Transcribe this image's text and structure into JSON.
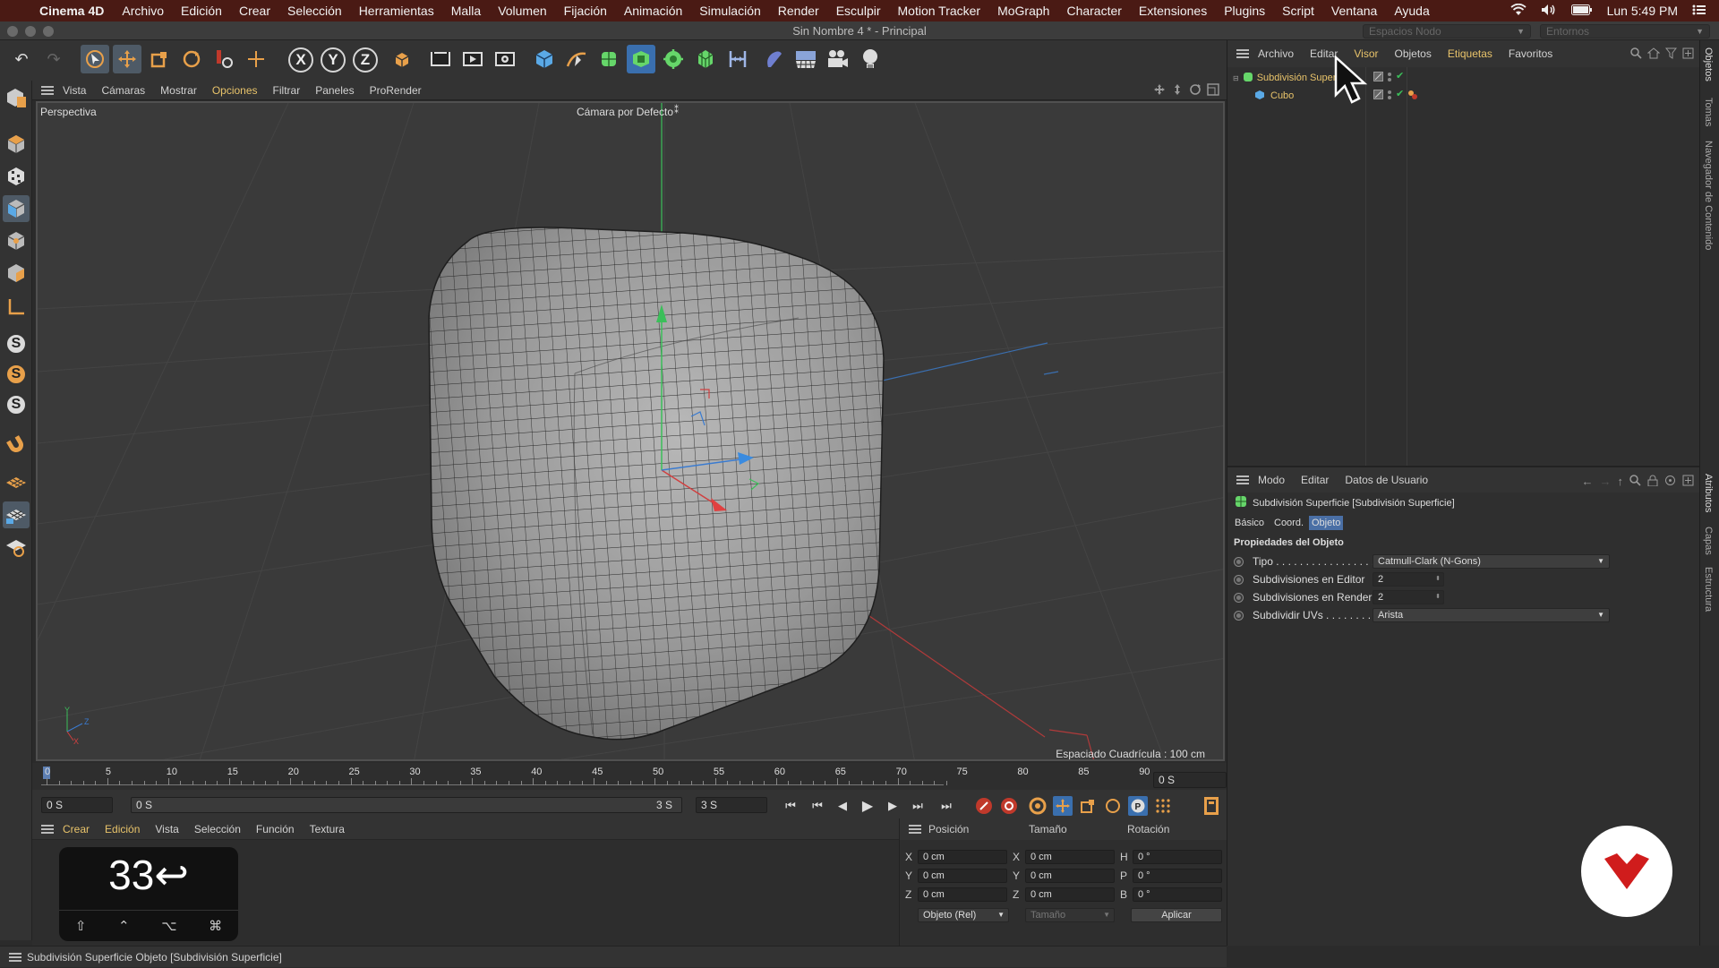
{
  "mac": {
    "app_name": "Cinema 4D",
    "menus": [
      "Archivo",
      "Edición",
      "Crear",
      "Selección",
      "Herramientas",
      "Malla",
      "Volumen",
      "Fijación",
      "Animación",
      "Simulación",
      "Render",
      "Esculpir",
      "Motion Tracker",
      "MoGraph",
      "Character",
      "Extensiones",
      "Plugins",
      "Script",
      "Ventana",
      "Ayuda"
    ],
    "clock": "Lun 5:49 PM"
  },
  "window": {
    "title": "Sin Nombre 4 * - Principal",
    "layout_combo": "Espacios Nodo",
    "env_combo": "Entornos"
  },
  "viewport": {
    "menu": [
      "Vista",
      "Cámaras",
      "Mostrar",
      "Opciones",
      "Filtrar",
      "Paneles",
      "ProRender"
    ],
    "highlight_menu": "Opciones",
    "view_name": "Perspectiva",
    "camera": "Cámara por Defecto",
    "grid_spacing": "Espaciado Cuadrícula : 100 cm",
    "axis_y": "Y",
    "axis_z": "Z",
    "axis_x": "X"
  },
  "timeline": {
    "ticks": [
      "0",
      "5",
      "10",
      "15",
      "20",
      "25",
      "30",
      "35",
      "40",
      "45",
      "50",
      "55",
      "60",
      "65",
      "70",
      "75",
      "80",
      "85",
      "90"
    ],
    "current_frame": "0 S",
    "start": "0 S",
    "range_start": "0 S",
    "range_end": "3 S",
    "end": "3 S"
  },
  "material": {
    "menu": [
      "Crear",
      "Edición",
      "Vista",
      "Selección",
      "Función",
      "Textura"
    ],
    "highlight_menu": [
      "Crear",
      "Edición"
    ],
    "keycast_number": "33",
    "keycast_return": "↩",
    "keycast_keys": [
      "⇧",
      "⌃",
      "⌥",
      "⌘"
    ]
  },
  "coords": {
    "headers": {
      "position": "Posición",
      "size": "Tamaño",
      "rotation": "Rotación"
    },
    "rows": [
      {
        "axis": "X",
        "pos": "0 cm",
        "size_axis": "X",
        "size": "0 cm",
        "rot_axis": "H",
        "rot": "0 °"
      },
      {
        "axis": "Y",
        "pos": "0 cm",
        "size_axis": "Y",
        "size": "0 cm",
        "rot_axis": "P",
        "rot": "0 °"
      },
      {
        "axis": "Z",
        "pos": "0 cm",
        "size_axis": "Z",
        "size": "0 cm",
        "rot_axis": "B",
        "rot": "0 °"
      }
    ],
    "mode": "Objeto (Rel)",
    "size_mode": "Tamaño",
    "apply": "Aplicar"
  },
  "status": "Subdivisión Superficie Objeto [Subdivisión Superficie]",
  "objects": {
    "menu": [
      "Archivo",
      "Editar",
      "Visor",
      "Objetos",
      "Etiquetas",
      "Favoritos"
    ],
    "highlight_menu": [
      "Visor",
      "Etiquetas"
    ],
    "tree": [
      {
        "name": "Subdivisión Superficie",
        "level": 0
      },
      {
        "name": "Cubo",
        "level": 1
      }
    ]
  },
  "attributes": {
    "menu": [
      "Modo",
      "Editar",
      "Datos de Usuario"
    ],
    "object_title": "Subdivisión Superficie [Subdivisión Superficie]",
    "tabs": [
      "Básico",
      "Coord.",
      "Objeto"
    ],
    "active_tab": "Objeto",
    "section": "Propiedades del Objeto",
    "props": [
      {
        "label": "Tipo . . . . . . . . . . . . . . . . . .",
        "value": "Catmull-Clark (N-Gons)"
      },
      {
        "label": "Subdivisiones en Editor",
        "value": "2"
      },
      {
        "label": "Subdivisiones en Render",
        "value": "2"
      },
      {
        "label": "Subdividir UVs . . . . . . . .",
        "value": "Arista"
      }
    ]
  },
  "side_tabs": [
    "Objetos",
    "Tomas",
    "Navegador de Contenido",
    "Atributos",
    "Capas",
    "Estructura"
  ],
  "colors": {
    "accent_yellow": "#e8c36a",
    "menubar_bg": "#4a1a14",
    "selected_tab": "#4a6fa5"
  }
}
